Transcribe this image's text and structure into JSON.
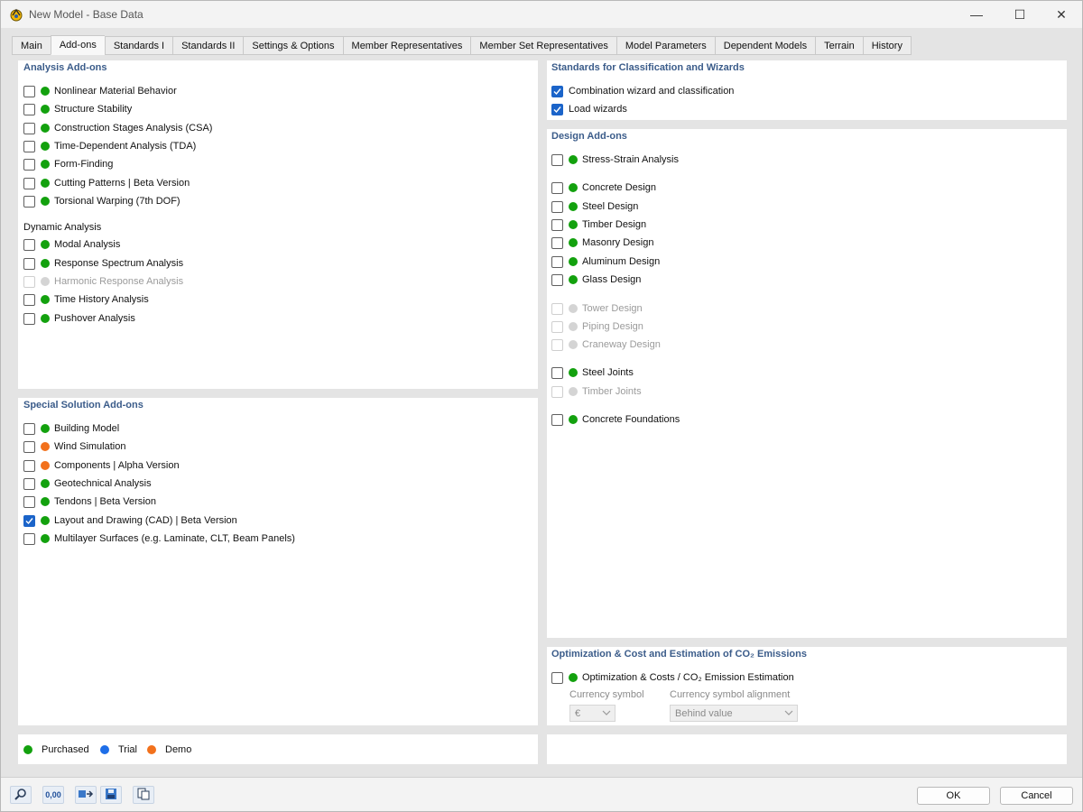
{
  "window": {
    "title": "New Model - Base Data",
    "minimize_glyph": "—",
    "maximize_glyph": "☐",
    "close_glyph": "✕"
  },
  "tabs": [
    {
      "label": "Main"
    },
    {
      "label": "Add-ons",
      "active": true
    },
    {
      "label": "Standards I"
    },
    {
      "label": "Standards II"
    },
    {
      "label": "Settings & Options"
    },
    {
      "label": "Member Representatives"
    },
    {
      "label": "Member Set Representatives"
    },
    {
      "label": "Model Parameters"
    },
    {
      "label": "Dependent Models"
    },
    {
      "label": "Terrain"
    },
    {
      "label": "History"
    }
  ],
  "colors": {
    "purchased": "#13a10e",
    "trial": "#1e6ee8",
    "demo": "#f2711c",
    "unavailable": "#d4d4d4",
    "section_title": "#3b5c8a",
    "checkbox_checked": "#1b64c9"
  },
  "analysis_addons": {
    "title": "Analysis Add-ons",
    "items": [
      {
        "label": "Nonlinear Material Behavior",
        "status": "purchased",
        "checked": false
      },
      {
        "label": "Structure Stability",
        "status": "purchased",
        "checked": false
      },
      {
        "label": "Construction Stages Analysis (CSA)",
        "status": "purchased",
        "checked": false
      },
      {
        "label": "Time-Dependent Analysis (TDA)",
        "status": "purchased",
        "checked": false
      },
      {
        "label": "Form-Finding",
        "status": "purchased",
        "checked": false
      },
      {
        "label": "Cutting Patterns | Beta Version",
        "status": "purchased",
        "checked": false
      },
      {
        "label": "Torsional Warping (7th DOF)",
        "status": "purchased",
        "checked": false
      }
    ],
    "dynamic_title": "Dynamic Analysis",
    "dynamic_items": [
      {
        "label": "Modal Analysis",
        "status": "purchased",
        "checked": false
      },
      {
        "label": "Response Spectrum Analysis",
        "status": "purchased",
        "checked": false
      },
      {
        "label": "Harmonic Response Analysis",
        "status": "unavailable",
        "checked": false,
        "disabled": true
      },
      {
        "label": "Time History Analysis",
        "status": "purchased",
        "checked": false
      },
      {
        "label": "Pushover Analysis",
        "status": "purchased",
        "checked": false
      }
    ]
  },
  "special_addons": {
    "title": "Special Solution Add-ons",
    "items": [
      {
        "label": "Building Model",
        "status": "purchased",
        "checked": false
      },
      {
        "label": "Wind Simulation",
        "status": "demo",
        "checked": false
      },
      {
        "label": "Components | Alpha Version",
        "status": "demo",
        "checked": false
      },
      {
        "label": "Geotechnical Analysis",
        "status": "purchased",
        "checked": false
      },
      {
        "label": "Tendons | Beta Version",
        "status": "purchased",
        "checked": false
      },
      {
        "label": "Layout and Drawing (CAD) | Beta Version",
        "status": "purchased",
        "checked": true
      },
      {
        "label": "Multilayer Surfaces (e.g. Laminate, CLT, Beam Panels)",
        "status": "purchased",
        "checked": false
      }
    ]
  },
  "standards_wizards": {
    "title": "Standards for Classification and Wizards",
    "items": [
      {
        "label": "Combination wizard and classification",
        "checked": true
      },
      {
        "label": "Load wizards",
        "checked": true
      }
    ]
  },
  "design_addons": {
    "title": "Design Add-ons",
    "items": [
      {
        "label": "Stress-Strain Analysis",
        "status": "purchased",
        "checked": false
      },
      {
        "label": "Concrete Design",
        "status": "purchased",
        "checked": false
      },
      {
        "label": "Steel Design",
        "status": "purchased",
        "checked": false
      },
      {
        "label": "Timber Design",
        "status": "purchased",
        "checked": false
      },
      {
        "label": "Masonry Design",
        "status": "purchased",
        "checked": false
      },
      {
        "label": "Aluminum Design",
        "status": "purchased",
        "checked": false
      },
      {
        "label": "Glass Design",
        "status": "purchased",
        "checked": false
      },
      {
        "label": "Tower Design",
        "status": "unavailable",
        "checked": false,
        "disabled": true
      },
      {
        "label": "Piping Design",
        "status": "unavailable",
        "checked": false,
        "disabled": true
      },
      {
        "label": "Craneway Design",
        "status": "unavailable",
        "checked": false,
        "disabled": true
      },
      {
        "label": "Steel Joints",
        "status": "purchased",
        "checked": false
      },
      {
        "label": "Timber Joints",
        "status": "unavailable",
        "checked": false,
        "disabled": true
      },
      {
        "label": "Concrete Foundations",
        "status": "purchased",
        "checked": false
      }
    ]
  },
  "optimization": {
    "title": "Optimization & Cost and Estimation of CO₂ Emissions",
    "item": {
      "label": "Optimization & Costs / CO₂ Emission Estimation",
      "status": "purchased",
      "checked": false
    },
    "currency_symbol_label": "Currency symbol",
    "currency_symbol_value": "€",
    "alignment_label": "Currency symbol alignment",
    "alignment_value": "Behind value"
  },
  "legend": [
    {
      "label": "Purchased",
      "status": "purchased"
    },
    {
      "label": "Trial",
      "status": "trial"
    },
    {
      "label": "Demo",
      "status": "demo"
    }
  ],
  "footer": {
    "toolbar_icons": [
      "search-icon",
      "units-icon",
      "transfer-icon",
      "save-template-icon",
      "copy-icon"
    ],
    "units_text": "0,00",
    "ok_label": "OK",
    "cancel_label": "Cancel"
  }
}
